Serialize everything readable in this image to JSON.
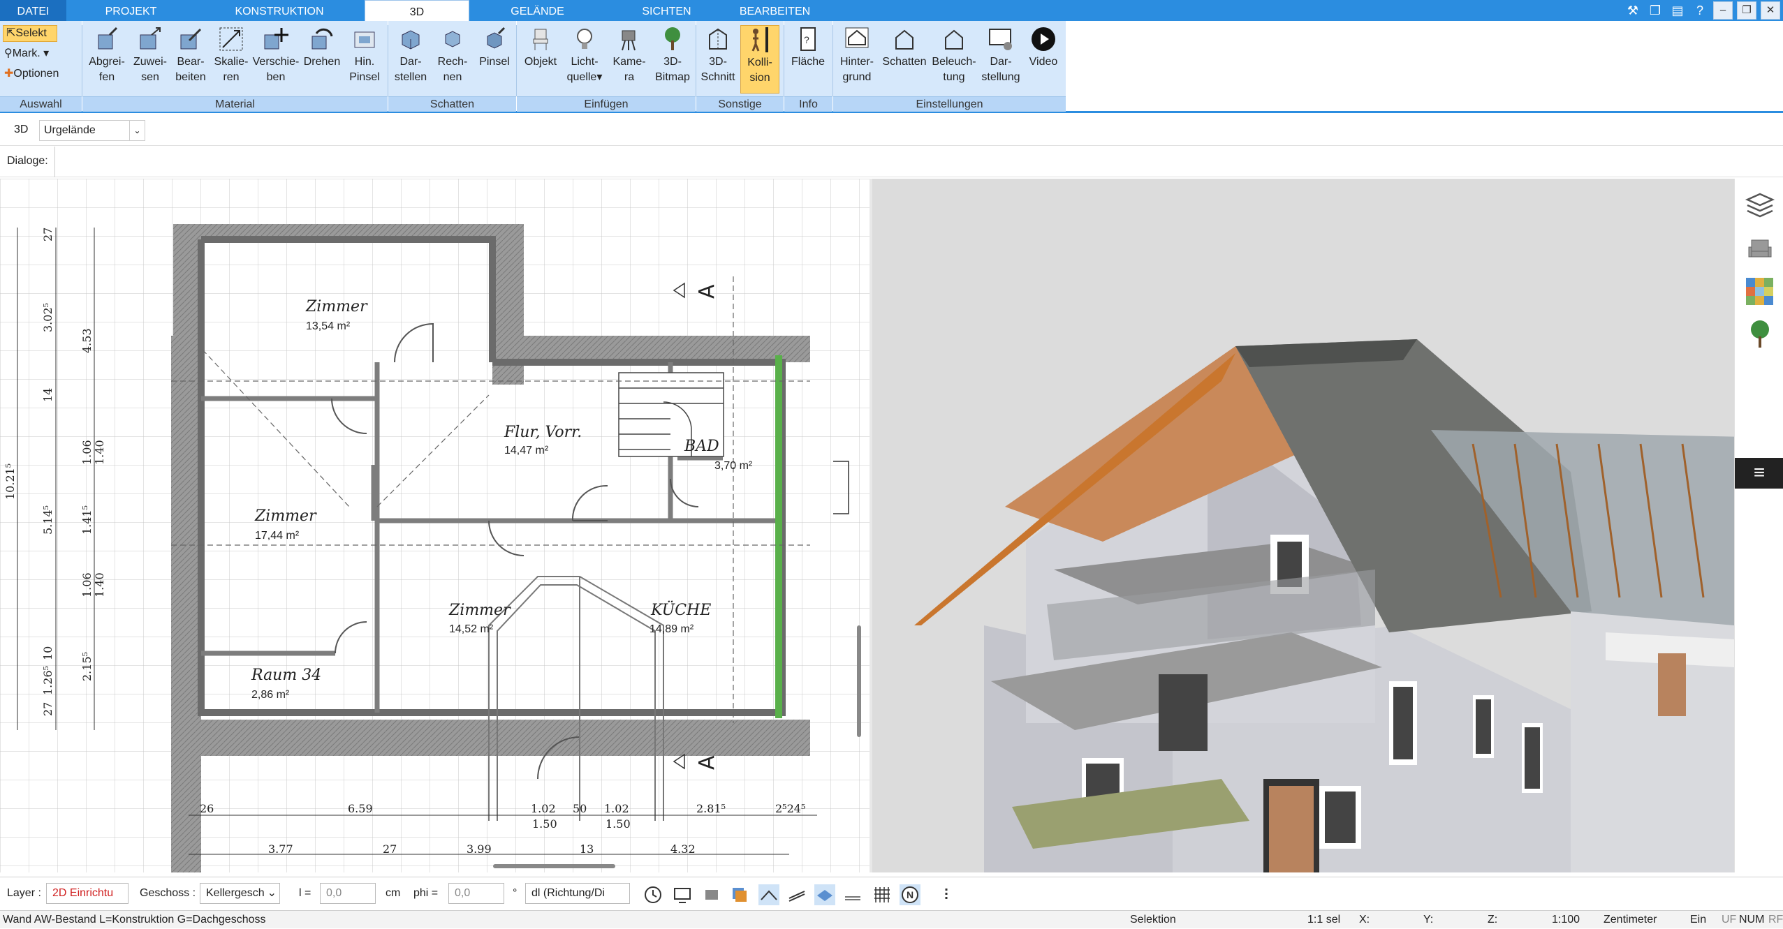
{
  "menu_tabs": [
    "DATEI",
    "PROJEKT",
    "KONSTRUKTION",
    "3D",
    "GELÄNDE",
    "SICHTEN",
    "BEARBEITEN"
  ],
  "active_tab": "3D",
  "ribbon": {
    "auswahl": {
      "select": "Selekt",
      "mark": "Mark.",
      "options": "Optionen",
      "label": "Auswahl"
    },
    "material": {
      "label": "Material",
      "buttons": [
        "Abgrei-\nfen",
        "Zuwei-\nsen",
        "Bear-\nbeiten",
        "Skalie-\nren",
        "Verschie-\nben",
        "Drehen",
        "Hin.\nPinsel"
      ]
    },
    "schatten": {
      "label": "Schatten",
      "buttons": [
        "Dar-\nstellen",
        "Rech-\nnen",
        "Pinsel"
      ]
    },
    "einfuegen": {
      "label": "Einfügen",
      "buttons": [
        "Objekt",
        "Licht-\nquelle",
        "Kame-\nra",
        "3D-\nBitmap"
      ]
    },
    "sonstige": {
      "label": "Sonstige",
      "buttons": [
        "3D-\nSchnitt",
        "Kolli-\nsion"
      ]
    },
    "info": {
      "label": "Info",
      "buttons": [
        "Fläche"
      ]
    },
    "einstellungen": {
      "label": "Einstellungen",
      "buttons": [
        "Hinter-\ngrund",
        "Schatten",
        "Beleuch-\ntung",
        "Dar-\nstellung",
        "Video"
      ]
    }
  },
  "view_mode": "3D",
  "terrain_select": "Urgelände",
  "dialoge_label": "Dialoge:",
  "plan": {
    "rooms": [
      {
        "name": "Zimmer",
        "area": "13,54 m²"
      },
      {
        "name": "Flur, Vorr.",
        "area": "14,47 m²"
      },
      {
        "name": "BAD",
        "area": "3,70 m²"
      },
      {
        "name": "Zimmer",
        "area": "17,44 m²"
      },
      {
        "name": "Zimmer",
        "area": "14,52 m²"
      },
      {
        "name": "KÜCHE",
        "area": "14,89 m²"
      },
      {
        "name": "Raum 34",
        "area": "2,86 m²"
      }
    ],
    "section_label": "A",
    "dims_bottom_1": [
      "26",
      "6.59",
      "1.02",
      "50",
      "1.02",
      "2.81⁵",
      "2⁵24⁵"
    ],
    "dims_bottom_1b": [
      "1.50",
      "1.50"
    ],
    "dims_bottom_2": [
      "3.77",
      "27",
      "3.99",
      "13",
      "4.32"
    ],
    "dims_left_a": [
      "27",
      "3.02⁵",
      "14",
      "5.14⁵",
      "10",
      "1.26⁵",
      "27"
    ],
    "dims_left_b": [
      "4.53",
      "1.06",
      "1.40",
      "1.41⁵",
      "1.06",
      "1.40",
      "2.15⁵"
    ],
    "dims_left_c": [
      "10.21⁵"
    ]
  },
  "bottom": {
    "layer_label": "Layer :",
    "layer_value": "2D Einrichtu",
    "geschoss_label": "Geschoss :",
    "geschoss_value": "Kellergesch",
    "l_label": "l =",
    "l_value": "0,0",
    "l_unit": "cm",
    "phi_label": "phi =",
    "phi_value": "0,0",
    "phi_unit": "°",
    "dl_value": "dl (Richtung/Di"
  },
  "status": {
    "left": "Wand AW-Bestand L=Konstruktion G=Dachgeschoss",
    "mode": "Selektion",
    "sel": "1:1 sel",
    "x": "X:",
    "y": "Y:",
    "z": "Z:",
    "scale": "1:100",
    "unit": "Zentimeter",
    "ein": "Ein",
    "uf": "UF",
    "num": "NUM",
    "rf": "RF"
  },
  "colors": {
    "accent": "#2b8de0",
    "ribbon_group": "#d6e8fb",
    "highlight": "#ffd56b"
  }
}
